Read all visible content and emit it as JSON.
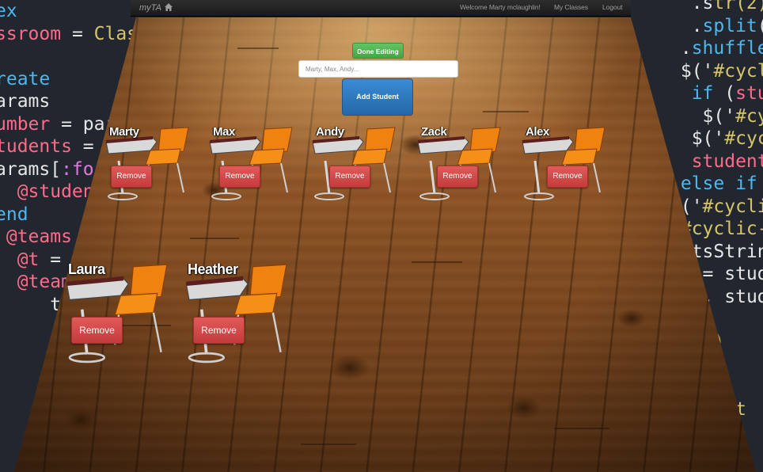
{
  "nav": {
    "brand": "myTA",
    "welcome": "Welcome Marty mclaughlin!",
    "my_classes": "My Classes",
    "logout": "Logout"
  },
  "controls": {
    "done_label": "Done Editing",
    "input_placeholder": "Marty, Max, Andy...",
    "add_label": "Add Student"
  },
  "students": [
    {
      "name": "Marty",
      "remove_label": "Remove"
    },
    {
      "name": "Max",
      "remove_label": "Remove"
    },
    {
      "name": "Andy",
      "remove_label": "Remove"
    },
    {
      "name": "Zack",
      "remove_label": "Remove"
    },
    {
      "name": "Alex",
      "remove_label": "Remove"
    },
    {
      "name": "Laura",
      "remove_label": "Remove"
    },
    {
      "name": "Heather",
      "remove_label": "Remove"
    }
  ],
  "colors": {
    "navbar": "#1f1f1f",
    "done_button": "#5cb85c",
    "add_button": "#2f78bf",
    "remove_button": "#d9534f",
    "chair": "#f58f17",
    "floor": "#8c5224"
  }
}
